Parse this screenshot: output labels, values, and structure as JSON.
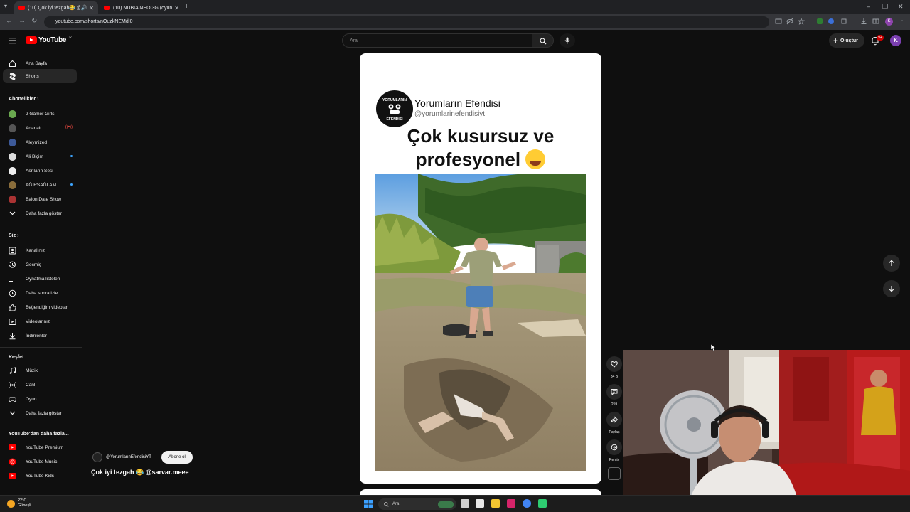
{
  "browser": {
    "tabs": [
      {
        "title": "(10) Çok iyi tezgah😂 @sa",
        "active": true
      },
      {
        "title": "(10) NUBIA NEO 3G (oyuncu te",
        "active": false
      }
    ],
    "url": "youtube.com/shorts/nOuzkNEMdI0"
  },
  "header": {
    "logo_text": "YouTube",
    "country_code": "TR",
    "search_placeholder": "Ara",
    "create_label": "Oluştur",
    "notification_count": "9+",
    "avatar_letter": "K"
  },
  "sidebar": {
    "main": [
      {
        "label": "Ana Sayfa",
        "icon": "home-icon"
      },
      {
        "label": "Shorts",
        "icon": "shorts-icon",
        "active": true
      }
    ],
    "subscriptions_title": "Abonelikler",
    "subscriptions": [
      {
        "label": "2 Gamer Girls",
        "color": "#6aa84f",
        "live": false
      },
      {
        "label": "Adanalı",
        "color": "#555555",
        "live": "red"
      },
      {
        "label": "Aleymized",
        "color": "#3d5a99",
        "live": false
      },
      {
        "label": "Ali Biçim",
        "color": "#dddddd",
        "live": "dot"
      },
      {
        "label": "Asrıların Sesi",
        "color": "#eeeeee",
        "live": false
      },
      {
        "label": "AĞIRSAĞLAM",
        "color": "#8a6d3b",
        "live": "dot"
      },
      {
        "label": "Balon Date Show",
        "color": "#aa3333",
        "live": false
      }
    ],
    "show_more": "Daha fazla göster",
    "you_title": "Siz",
    "you_items": [
      {
        "label": "Kanalınız",
        "icon": "channel-icon"
      },
      {
        "label": "Geçmiş",
        "icon": "history-icon"
      },
      {
        "label": "Oynatma listeleri",
        "icon": "playlist-icon"
      },
      {
        "label": "Daha sonra izle",
        "icon": "clock-icon"
      },
      {
        "label": "Beğendiğim videolar",
        "icon": "thumbs-up-icon"
      },
      {
        "label": "Videolarınız",
        "icon": "video-icon"
      },
      {
        "label": "İndirilenler",
        "icon": "download-icon"
      }
    ],
    "explore_title": "Keşfet",
    "explore_items": [
      {
        "label": "Müzik",
        "icon": "music-icon"
      },
      {
        "label": "Canlı",
        "icon": "live-icon"
      },
      {
        "label": "Oyun",
        "icon": "gamepad-icon"
      }
    ],
    "explore_more": "Daha fazla göster",
    "more_title": "YouTube'dan daha fazla...",
    "more_items": [
      {
        "label": "YouTube Premium",
        "icon": "yt-premium-icon"
      },
      {
        "label": "YouTube Music",
        "icon": "yt-music-icon"
      },
      {
        "label": "YouTube Kids",
        "icon": "yt-kids-icon"
      }
    ]
  },
  "short": {
    "channel_name": "Yorumların Efendisi",
    "channel_handle": "@yorumlarinefendisiyt",
    "logo_line1": "YORUMLARIN",
    "logo_line2": "EFENDİSİ",
    "caption_line1": "Çok kusursuz ve",
    "caption_line2": "profesyonel",
    "overlay_channel": "@YorumlarınEfendisiYT",
    "subscribe_label": "Abone ol",
    "overlay_caption": "Çok iyi tezgah 😂 @sarvar.meee"
  },
  "actions": [
    {
      "name": "like",
      "label": "34 B",
      "icon": "heart-icon"
    },
    {
      "name": "comment",
      "label": "259",
      "icon": "comment-icon"
    },
    {
      "name": "share",
      "label": "Paylaş",
      "icon": "share-icon"
    },
    {
      "name": "remix",
      "label": "Remix",
      "icon": "remix-icon"
    }
  ],
  "taskbar": {
    "temperature": "22°C",
    "weather": "Güneşli",
    "search_label": "Ara"
  }
}
